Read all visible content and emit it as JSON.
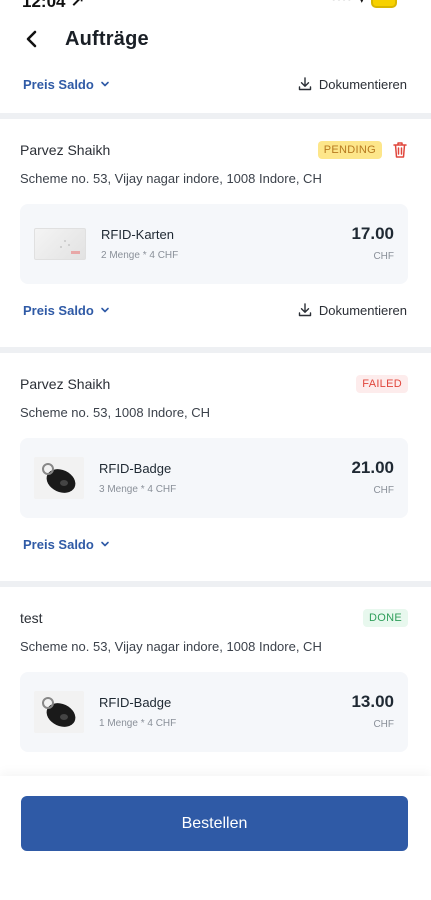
{
  "status_bar": {
    "time": "12:04 ↗"
  },
  "header": {
    "title": "Aufträge"
  },
  "top_actions": {
    "preis_saldo": "Preis Saldo",
    "documentieren": "Dokumentieren"
  },
  "orders": [
    {
      "name_visible": "Parvez Shaikh",
      "status": "PENDING",
      "address": "Scheme no. 53, Vijay nagar indore, 1008 Indore, CH",
      "item": {
        "name": "RFID-Karten",
        "qty": "2 Menge * 4 CHF",
        "price": "17.00",
        "currency": "CHF"
      },
      "preis_saldo": "Preis Saldo",
      "documentieren": "Dokumentieren"
    },
    {
      "name_visible": "Parvez Shaikh",
      "status": "FAILED",
      "address": "Scheme no. 53, 1008 Indore, CH",
      "item": {
        "name": "RFID-Badge",
        "qty": "3 Menge * 4 CHF",
        "price": "21.00",
        "currency": "CHF"
      },
      "preis_saldo": "Preis Saldo"
    },
    {
      "name_visible": "test",
      "status": "DONE",
      "address": "Scheme no. 53, Vijay nagar indore, 1008 Indore, CH",
      "item": {
        "name": "RFID-Badge",
        "qty": "1 Menge * 4 CHF",
        "price": "13.00",
        "currency": "CHF"
      }
    }
  ],
  "bottom": {
    "order_button": "Bestellen"
  },
  "colors": {
    "accent": "#2f5aa6",
    "pending_bg": "#fde68a",
    "failed_text": "#e0463c",
    "done_text": "#2f9e5a"
  }
}
